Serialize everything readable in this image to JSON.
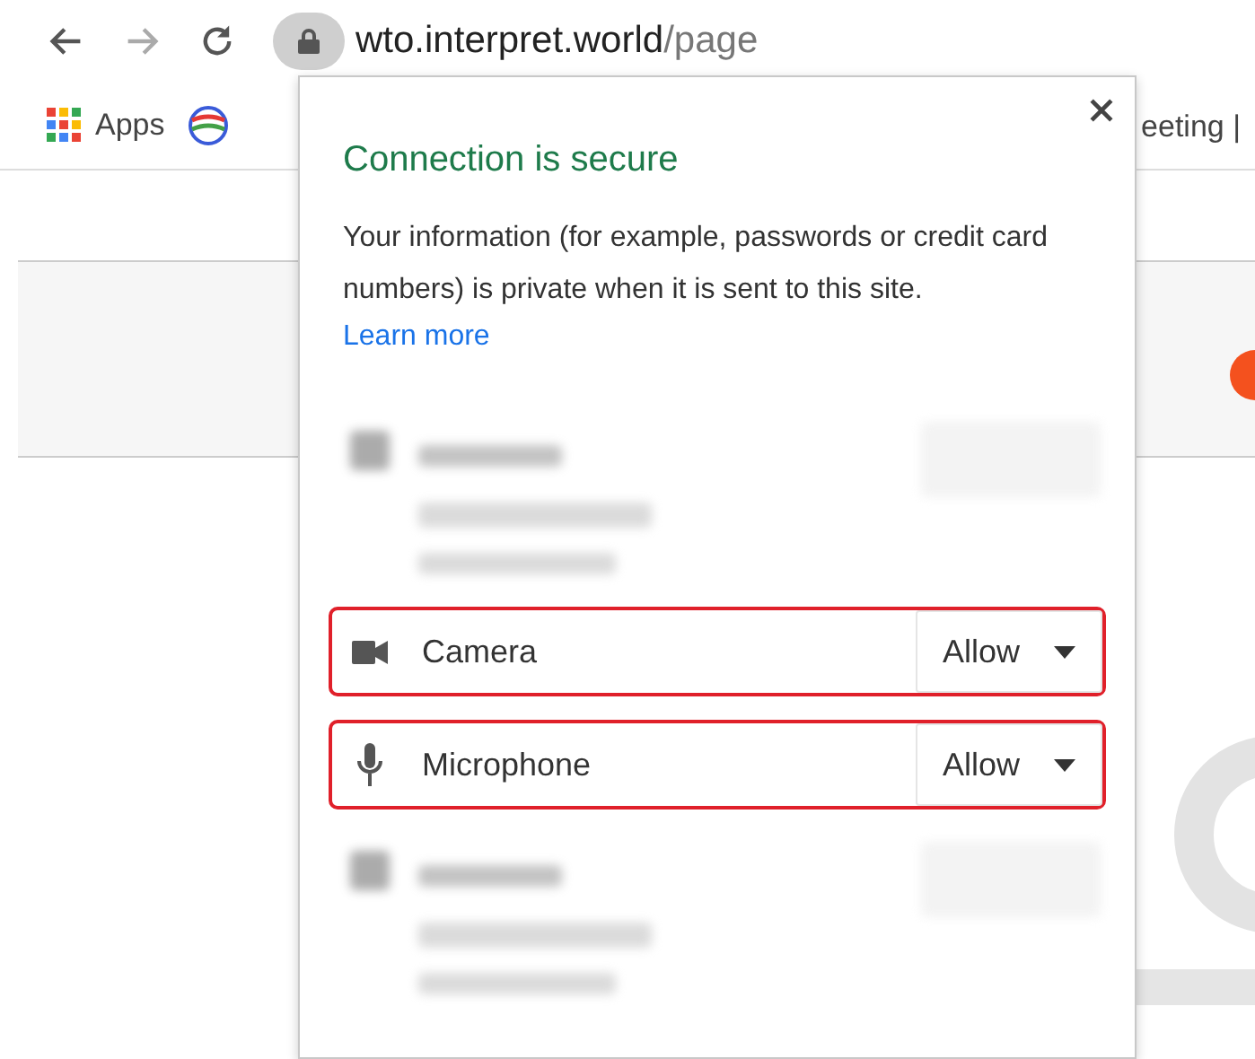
{
  "toolbar": {
    "url_host": "wto.interpret.world",
    "url_path": "/page"
  },
  "bookmarks": [
    {
      "label": "Apps",
      "kind": "apps"
    },
    {
      "label": "eeting |",
      "kind": "text"
    }
  ],
  "popup": {
    "title": "Connection is secure",
    "description": "Your information (for example, passwords or credit card numbers) is private when it is sent to this site.",
    "link": "Learn more",
    "permissions": [
      {
        "kind": "blurred",
        "highlighted": false
      },
      {
        "kind": "camera",
        "label": "Camera",
        "value": "Allow",
        "highlighted": true
      },
      {
        "kind": "microphone",
        "label": "Microphone",
        "value": "Allow",
        "highlighted": true
      },
      {
        "kind": "blurred",
        "highlighted": false
      }
    ]
  }
}
